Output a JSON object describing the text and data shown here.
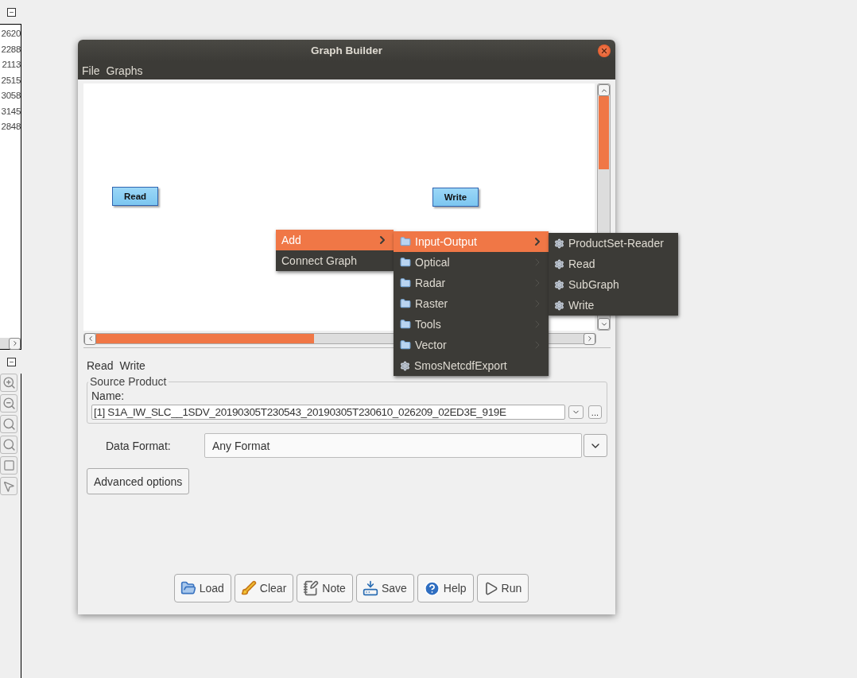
{
  "left_panel": {
    "values": [
      "2620",
      "2288",
      "2113",
      "2515",
      "3058",
      "3145",
      "2848"
    ],
    "tools": [
      {
        "kind": "zoom-in"
      },
      {
        "kind": "zoom-out"
      },
      {
        "kind": "zoom"
      },
      {
        "kind": "zoom"
      },
      {
        "kind": "shape"
      },
      {
        "kind": "pointer"
      }
    ]
  },
  "window": {
    "title": "Graph Builder",
    "menu": [
      "File",
      "Graphs"
    ],
    "graph": {
      "nodes": [
        {
          "label": "Read"
        },
        {
          "label": "Write"
        }
      ]
    },
    "node_tabs": [
      "Read",
      "Write"
    ],
    "source_product": {
      "title": "Source Product",
      "name_label": "Name:",
      "value": "[1] S1A_IW_SLC__1SDV_20190305T230543_20190305T230610_026209_02ED3E_919E",
      "browse": "..."
    },
    "data_format": {
      "label": "Data Format:",
      "value": "Any Format"
    },
    "advanced_button": "Advanced options",
    "buttons": [
      {
        "label": "Load",
        "kind": "load"
      },
      {
        "label": "Clear",
        "kind": "clear"
      },
      {
        "label": "Note",
        "kind": "note"
      },
      {
        "label": "Save",
        "kind": "save"
      },
      {
        "label": "Help",
        "kind": "help"
      },
      {
        "label": "Run",
        "kind": "run"
      }
    ]
  },
  "context_menu": {
    "items": [
      {
        "label": "Add",
        "selected": true,
        "submenu": true
      },
      {
        "label": "Connect Graph",
        "selected": false,
        "submenu": false
      }
    ]
  },
  "add_submenu": {
    "items": [
      {
        "label": "Input-Output",
        "kind": "folder",
        "selected": true
      },
      {
        "label": "Optical",
        "kind": "folder",
        "selected": false
      },
      {
        "label": "Radar",
        "kind": "folder",
        "selected": false
      },
      {
        "label": "Raster",
        "kind": "folder",
        "selected": false
      },
      {
        "label": "Tools",
        "kind": "folder",
        "selected": false
      },
      {
        "label": "Vector",
        "kind": "folder",
        "selected": false
      },
      {
        "label": "SmosNetcdfExport",
        "kind": "operator",
        "selected": false
      }
    ]
  },
  "operator_submenu": {
    "items": [
      {
        "label": "ProductSet-Reader",
        "selected": false
      },
      {
        "label": "Read",
        "selected": false
      },
      {
        "label": "SubGraph",
        "selected": false
      },
      {
        "label": "Write",
        "selected": false
      }
    ]
  }
}
